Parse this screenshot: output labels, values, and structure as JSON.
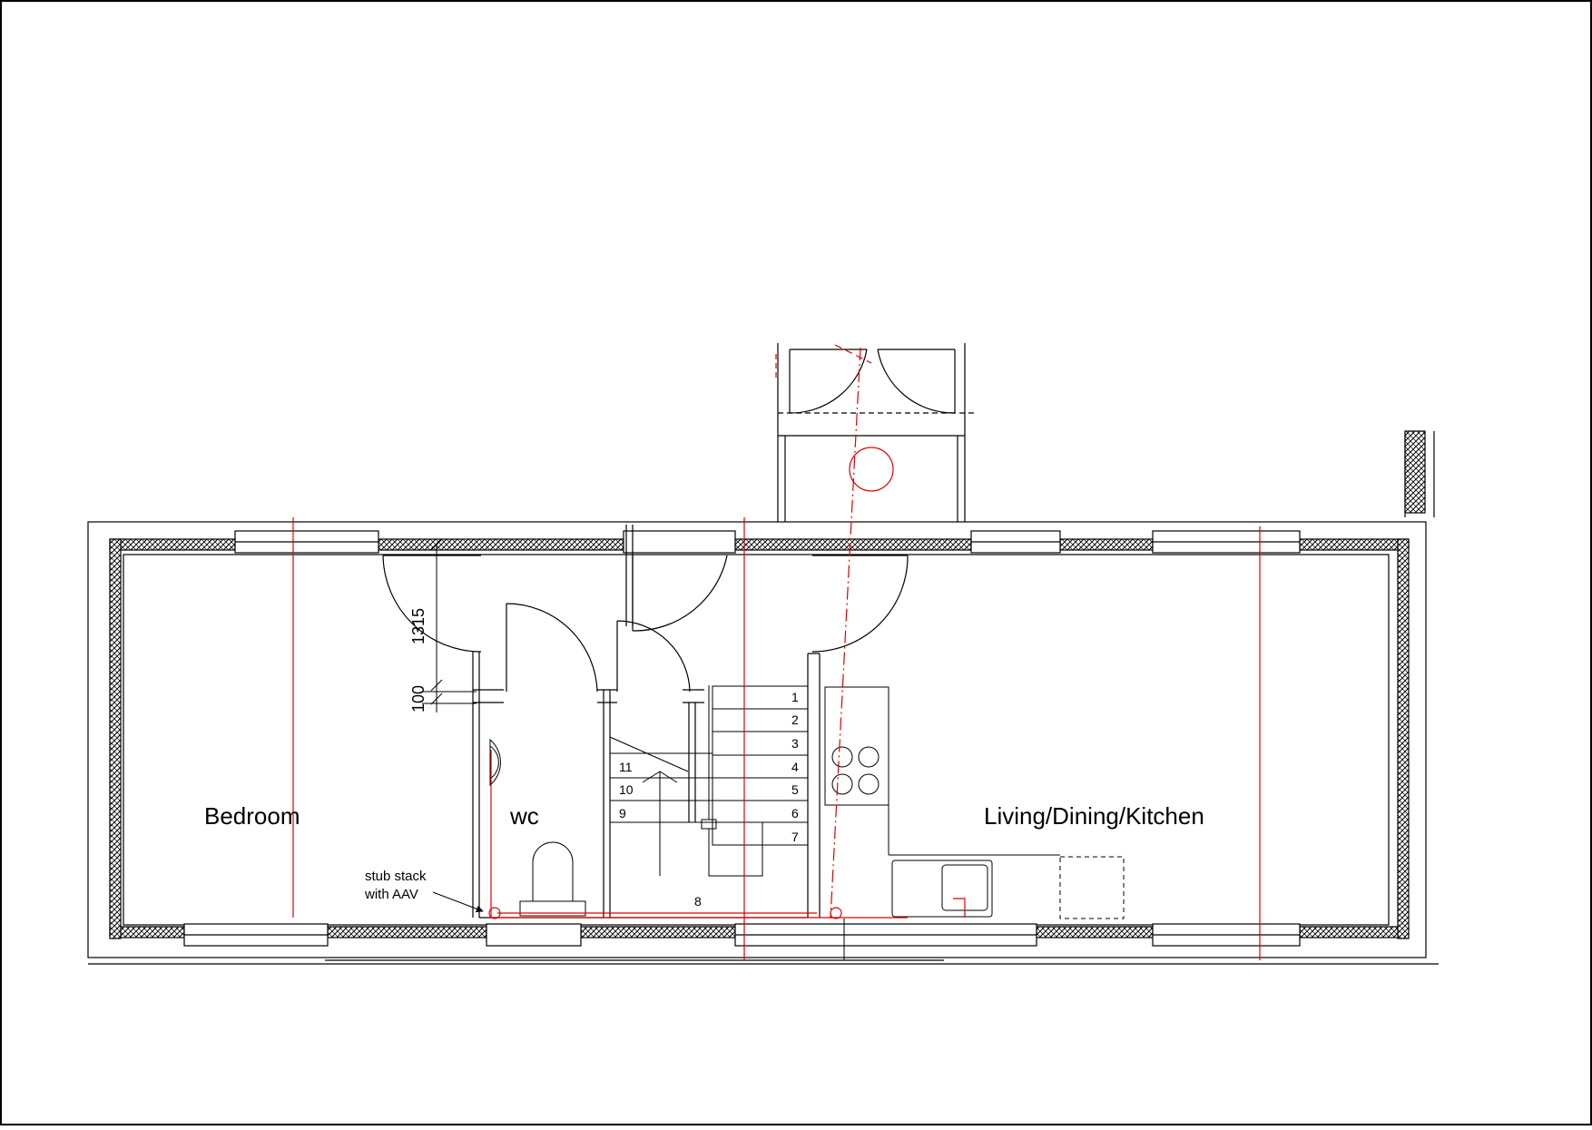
{
  "rooms": {
    "bedroom": "Bedroom",
    "wc": "wc",
    "living": "Living/Dining/Kitchen"
  },
  "annotations": {
    "stub_stack_line1": "stub stack",
    "stub_stack_line2": "with AAV"
  },
  "dimensions": {
    "d1315": "1315",
    "d100": "100"
  },
  "stairs": {
    "steps": [
      "1",
      "2",
      "3",
      "4",
      "5",
      "6",
      "7",
      "8",
      "9",
      "10",
      "11"
    ]
  },
  "colors": {
    "line": "#000000",
    "drainage": "#e00000",
    "insulation": "#000000"
  }
}
